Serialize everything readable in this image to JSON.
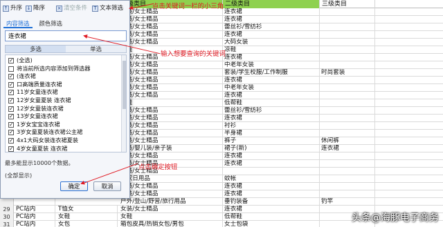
{
  "sheet": {
    "headers": [
      {
        "text": "",
        "highlight": false
      },
      {
        "text": "一级类目",
        "highlight": true
      },
      {
        "text": "二级类目",
        "highlight": true
      },
      {
        "text": "三级类目",
        "highlight": false
      }
    ],
    "rows": [
      {
        "num": "",
        "a": "",
        "b": "女装/女士精品",
        "c": "连衣裙",
        "d": ""
      },
      {
        "num": "",
        "a": "",
        "b": "女装/女士精品",
        "c": "连衣裙",
        "d": ""
      },
      {
        "num": "",
        "a": "",
        "b": "女装/女士精品",
        "c": "蕾丝衫/雪纺衫",
        "d": ""
      },
      {
        "num": "",
        "a": "",
        "b": "女装/女士精品",
        "c": "连衣裙",
        "d": ""
      },
      {
        "num": "",
        "a": "",
        "b": "女装/女士精品",
        "c": "大码女装",
        "d": ""
      },
      {
        "num": "",
        "a": "",
        "b": "女鞋",
        "c": "凉鞋",
        "d": ""
      },
      {
        "num": "",
        "a": "",
        "b": "女装/女士精品",
        "c": "连衣裙",
        "d": ""
      },
      {
        "num": "",
        "a": "",
        "b": "女装/女士精品",
        "c": "中老年女装",
        "d": ""
      },
      {
        "num": "",
        "a": "",
        "b": "女装/女士精品",
        "c": "套装/学生校服/工作制服",
        "d": "时尚套装"
      },
      {
        "num": "",
        "a": "",
        "b": "女装/女士精品",
        "c": "连衣裙",
        "d": ""
      },
      {
        "num": "",
        "a": "",
        "b": "女装/女士精品",
        "c": "中老年女装",
        "d": ""
      },
      {
        "num": "",
        "a": "",
        "b": "女装/女士精品",
        "c": "连衣裙",
        "d": ""
      },
      {
        "num": "",
        "a": "",
        "b": "男鞋",
        "c": "低帮鞋",
        "d": ""
      },
      {
        "num": "",
        "a": "",
        "b": "女装/女士精品",
        "c": "蕾丝衫/雪纺衫",
        "d": ""
      },
      {
        "num": "",
        "a": "",
        "b": "女装/女士精品",
        "c": "连衣裙",
        "d": ""
      },
      {
        "num": "",
        "a": "",
        "b": "女装/女士精品",
        "c": "衬衫",
        "d": ""
      },
      {
        "num": "",
        "a": "",
        "b": "女装/女士精品",
        "c": "半身裙",
        "d": ""
      },
      {
        "num": "",
        "a": "",
        "b": "女装/女士精品",
        "c": "裤子",
        "d": "休闲裤"
      },
      {
        "num": "",
        "a": "",
        "b": "童装/婴儿装/亲子装",
        "c": "裙子(新)",
        "d": "连衣裙"
      },
      {
        "num": "",
        "a": "",
        "b": "女装/女士精品",
        "c": "连衣裙",
        "d": ""
      },
      {
        "num": "",
        "a": "",
        "b": "女装/女士精品",
        "c": "连衣裙",
        "d": ""
      },
      {
        "num": "",
        "a": "",
        "b": "女装/女士精品",
        "c": "",
        "d": ""
      },
      {
        "num": "",
        "a": "",
        "b": "居家日用品",
        "c": "蚊帐",
        "d": ""
      },
      {
        "num": "",
        "a": "",
        "b": "女装/女士精品",
        "c": "连衣裙",
        "d": ""
      },
      {
        "num": "",
        "a": "",
        "b": "女装/女士精品",
        "c": "连衣裙",
        "d": ""
      },
      {
        "num": "",
        "a": "",
        "b": "户外/登山/野营/旅行用品",
        "c": "垂钓装备",
        "d": "钓竿"
      },
      {
        "num": "29",
        "a": "PC站内",
        "b": "女装/女士精品",
        "c": "连衣裙",
        "d": ""
      },
      {
        "num": "30",
        "a": "PC站内",
        "b": "女鞋",
        "c": "低帮鞋",
        "d": ""
      },
      {
        "num": "31",
        "a": "PC站内",
        "b": "箱包皮具/热销女包/男包",
        "c": "女士包袋",
        "d": ""
      }
    ],
    "partial_cells": [
      "T恤女",
      "女鞋",
      "女包"
    ]
  },
  "filter_panel": {
    "toolbar": {
      "sort_asc": "升序",
      "sort_desc": "降序",
      "clear": "清空条件",
      "text_filter": "文本筛选"
    },
    "tabs": [
      "内容筛选",
      "颜色筛选"
    ],
    "search_value": "连衣裙",
    "modes": [
      "多选",
      "单选"
    ],
    "items": [
      {
        "label": "(全选)",
        "checked": true
      },
      {
        "label": "将当前所选内容添加到筛选器",
        "checked": false
      },
      {
        "label": "(连衣裙",
        "checked": true
      },
      {
        "label": "口高端质量连衣裙",
        "checked": true
      },
      {
        "label": "11岁女童连衣裙",
        "checked": true
      },
      {
        "label": "12岁女童夏装 连衣裙",
        "checked": true
      },
      {
        "label": "12岁女童装连衣裙",
        "checked": true
      },
      {
        "label": "13岁女童连衣裙",
        "checked": true
      },
      {
        "label": "1岁女宝宝连衣裙",
        "checked": true
      },
      {
        "label": "3岁女童夏装连衣裙公主裙",
        "checked": true
      },
      {
        "label": "4x1大码女装连衣裙夏装",
        "checked": true
      },
      {
        "label": "4岁女童夏装 连衣裙",
        "checked": true
      }
    ],
    "hint_max": "最多能显示10000个数据。",
    "hint_all": "(全部显示)",
    "ok": "确定",
    "cancel": "取消"
  },
  "annotations": {
    "click_triangle": "点击关键词一栏的小三角",
    "type_keyword": "输入想要查询的关键词",
    "click_ok": "点击确定按钮"
  },
  "watermark": "头条@海豚电子商务"
}
